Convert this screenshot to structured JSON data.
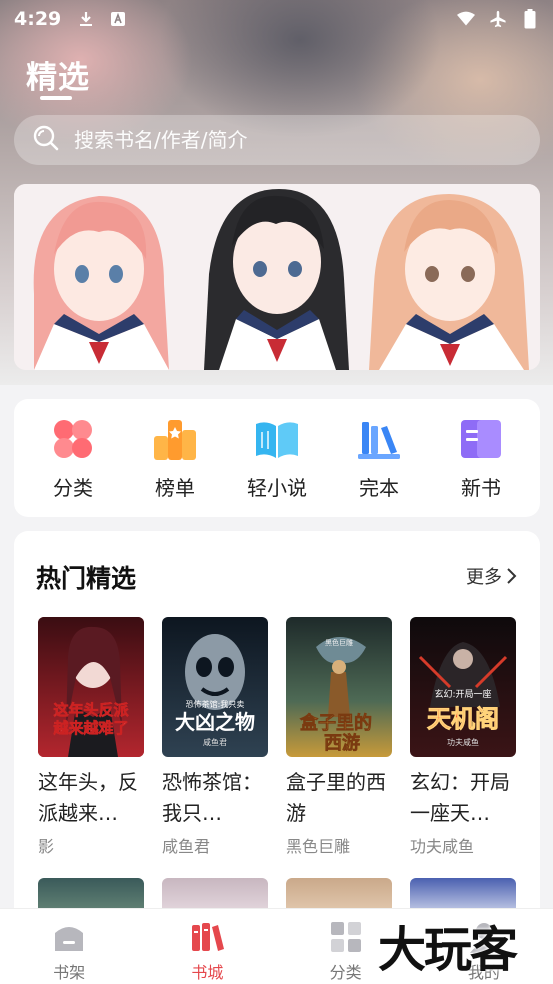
{
  "status_bar": {
    "time": "4:29",
    "left_icons": [
      "download-icon",
      "a-notification-icon"
    ],
    "right_icons": [
      "wifi-icon",
      "airplane-icon",
      "battery-icon"
    ]
  },
  "header": {
    "title": "精选",
    "search_placeholder": "搜索书名/作者/简介"
  },
  "categories": [
    {
      "label": "分类",
      "icon": "grid-icon",
      "color": "#ff6b73"
    },
    {
      "label": "榜单",
      "icon": "ranking-icon",
      "color": "#ffa33a"
    },
    {
      "label": "轻小说",
      "icon": "open-book-icon",
      "color": "#35b5f0"
    },
    {
      "label": "完本",
      "icon": "books-icon",
      "color": "#3a86f5"
    },
    {
      "label": "新书",
      "icon": "new-book-icon",
      "color": "#8e6cf6"
    }
  ],
  "hot": {
    "title": "热门精选",
    "more": "更多",
    "books": [
      {
        "title": "这年头，反派越来…",
        "author": "影",
        "cover_text": "这年头反派越来越难了",
        "cover_color": "#8a1b22"
      },
      {
        "title": "恐怖茶馆：我只…",
        "author": "咸鱼君",
        "cover_text": "大凶之物",
        "cover_color": "#1d2a38"
      },
      {
        "title": "盒子里的西游",
        "author": "黑色巨雕",
        "cover_text": "盒子里的西游",
        "cover_color": "#3a4a34"
      },
      {
        "title": "玄幻：开局一座天…",
        "author": "功夫咸鱼",
        "cover_text": "天机阁",
        "cover_color": "#1a1416"
      }
    ]
  },
  "bottom_nav": [
    {
      "label": "书架",
      "icon": "bookshelf-icon",
      "active": false
    },
    {
      "label": "书城",
      "icon": "bookstore-icon",
      "active": true
    },
    {
      "label": "分类",
      "icon": "category-icon",
      "active": false
    },
    {
      "label": "我的",
      "icon": "profile-icon",
      "active": false
    }
  ],
  "watermark": "大玩客",
  "colors": {
    "accent": "#e5484d"
  }
}
